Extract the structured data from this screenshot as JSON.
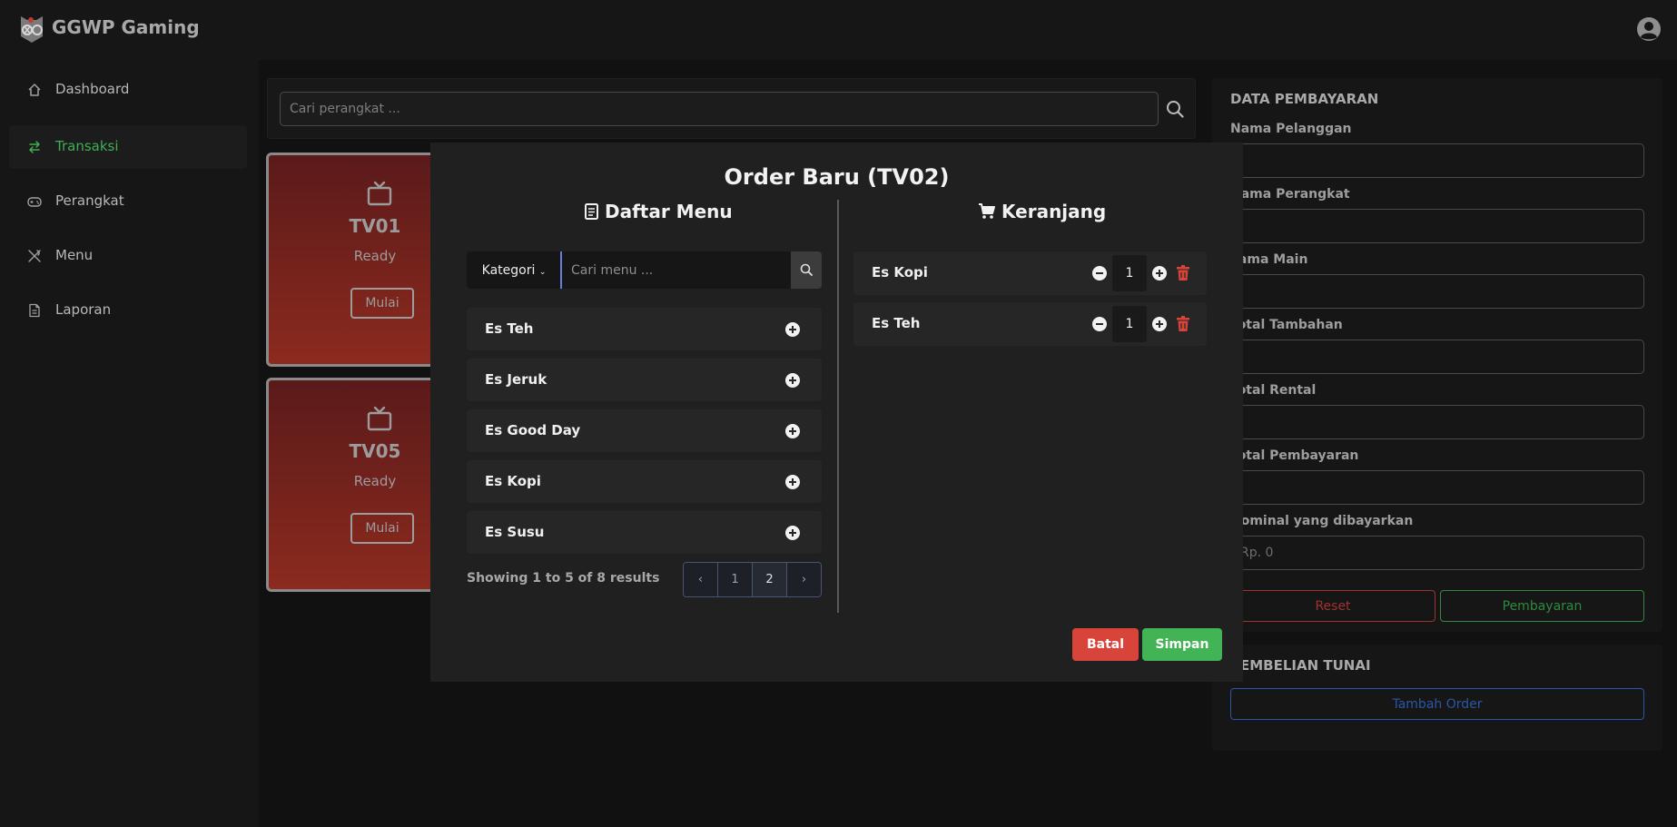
{
  "app": {
    "brand": "GGWP Gaming"
  },
  "sidebar": {
    "items": [
      {
        "label": "Dashboard",
        "icon": "home-icon",
        "active": false
      },
      {
        "label": "Transaksi",
        "icon": "transfer-arrows-icon",
        "active": true
      },
      {
        "label": "Perangkat",
        "icon": "gamepad-icon",
        "active": false
      },
      {
        "label": "Menu",
        "icon": "utensils-icon",
        "active": false
      },
      {
        "label": "Laporan",
        "icon": "document-icon",
        "active": false
      }
    ]
  },
  "devices": {
    "search_placeholder": "Cari perangkat ...",
    "cards": [
      {
        "name": "TV01",
        "status": "Ready",
        "button": "Mulai"
      },
      {
        "name": "TV05",
        "status": "Ready",
        "button": "Mulai"
      }
    ]
  },
  "payment": {
    "title": "DATA PEMBAYARAN",
    "fields": [
      {
        "label": "Nama Pelanggan",
        "value": "",
        "placeholder": ""
      },
      {
        "label": "Nama Perangkat",
        "value": "",
        "placeholder": ""
      },
      {
        "label": "Lama Main",
        "value": "",
        "placeholder": ""
      },
      {
        "label": "Total Tambahan",
        "value": "",
        "placeholder": ""
      },
      {
        "label": "Total Rental",
        "value": "",
        "placeholder": ""
      },
      {
        "label": "Total Pembayaran",
        "value": "",
        "placeholder": ""
      },
      {
        "label": "Nominal yang dibayarkan",
        "value": "",
        "placeholder": "Rp. 0"
      }
    ],
    "reset_label": "Reset",
    "pay_label": "Pembayaran"
  },
  "cash_purchase": {
    "title": "PEMBELIAN TUNAI",
    "add_order_label": "Tambah Order"
  },
  "modal": {
    "title": "Order Baru (TV02)",
    "menu_title": "Daftar Menu",
    "cart_title": "Keranjang",
    "category_label": "Kategori",
    "menu_search_placeholder": "Cari menu ...",
    "menu_items": [
      {
        "name": "Es Teh"
      },
      {
        "name": "Es Jeruk"
      },
      {
        "name": "Es Good Day"
      },
      {
        "name": "Es Kopi"
      },
      {
        "name": "Es Susu"
      }
    ],
    "results_text": "Showing 1 to 5 of 8 results",
    "pagination": {
      "prev": "‹",
      "pages": [
        "1",
        "2"
      ],
      "next": "›"
    },
    "cart": [
      {
        "name": "Es Kopi",
        "qty": "1"
      },
      {
        "name": "Es Teh",
        "qty": "1"
      }
    ],
    "cancel_label": "Batal",
    "save_label": "Simpan"
  },
  "colors": {
    "accent_green": "#43b455",
    "danger_red": "#d9443a",
    "primary_blue": "#2a56a8",
    "device_card_red": "#8c2a1e"
  }
}
